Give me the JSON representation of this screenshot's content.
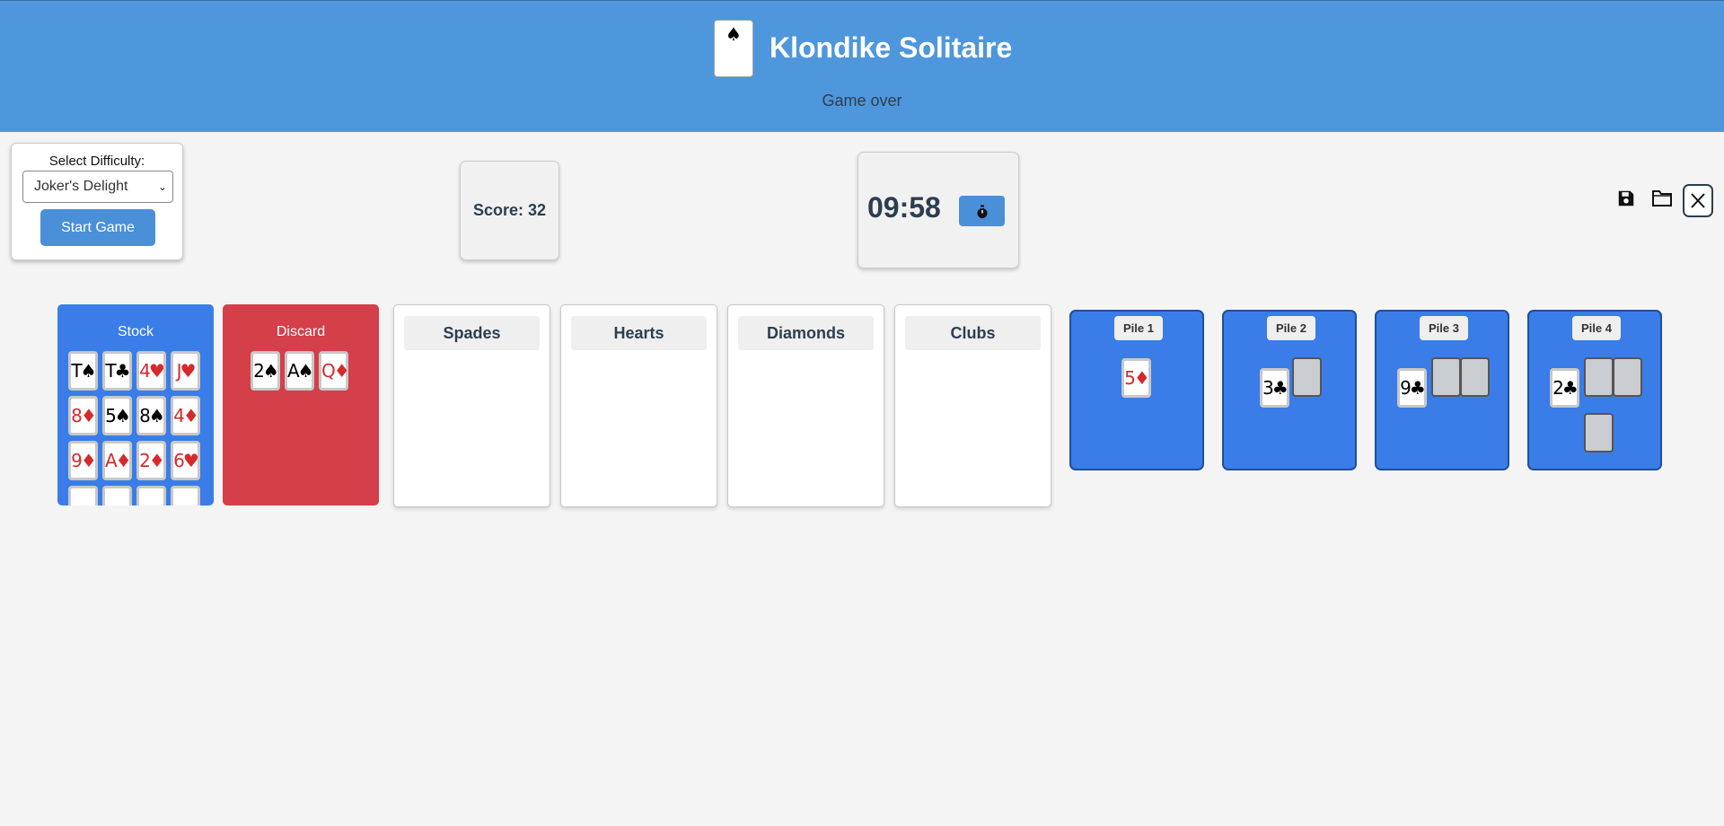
{
  "header": {
    "logo_suit": "♠",
    "title": "Klondike Solitaire",
    "status": "Game over"
  },
  "difficulty": {
    "label": "Select Difficulty:",
    "selected": "Joker's Delight",
    "start_label": "Start Game"
  },
  "score": {
    "text": "Score: 32"
  },
  "timer": {
    "value": "09:58",
    "button_icon": "stopwatch-icon"
  },
  "toolbar": {
    "icons": [
      "save-icon",
      "folder-icon",
      "close-icon"
    ]
  },
  "stock": {
    "label": "Stock",
    "cards": [
      {
        "t": "T♠",
        "red": false
      },
      {
        "t": "T♣",
        "red": false
      },
      {
        "t": "4♥",
        "red": true
      },
      {
        "t": "J♥",
        "red": true
      },
      {
        "t": "8♦",
        "red": true
      },
      {
        "t": "5♠",
        "red": false
      },
      {
        "t": "8♠",
        "red": false
      },
      {
        "t": "4♦",
        "red": true
      },
      {
        "t": "9♦",
        "red": true
      },
      {
        "t": "A♦",
        "red": true
      },
      {
        "t": "2♦",
        "red": true
      },
      {
        "t": "6♥",
        "red": true
      }
    ]
  },
  "discard": {
    "label": "Discard",
    "cards": [
      {
        "t": "2♠",
        "red": false
      },
      {
        "t": "A♠",
        "red": false
      },
      {
        "t": "Q♦",
        "red": true
      }
    ]
  },
  "foundations": [
    "Spades",
    "Hearts",
    "Diamonds",
    "Clubs"
  ],
  "tableau": [
    {
      "label": "Pile 1",
      "face_up": {
        "t": "5♦",
        "red": true
      },
      "face_down_count": 0
    },
    {
      "label": "Pile 2",
      "face_up": {
        "t": "3♣",
        "red": false
      },
      "face_down_count": 1
    },
    {
      "label": "Pile 3",
      "face_up": {
        "t": "9♣",
        "red": false
      },
      "face_down_count": 2
    },
    {
      "label": "Pile 4",
      "face_up": {
        "t": "2♣",
        "red": false
      },
      "face_down_count": 3
    }
  ],
  "colors": {
    "header_bg": "#4f97dc",
    "stock_bg": "#3a7de8",
    "discard_bg": "#d43f4a",
    "tableau_bg": "#3a7de8",
    "button_bg": "#4a90d9",
    "red_suit": "#d62a2a"
  }
}
